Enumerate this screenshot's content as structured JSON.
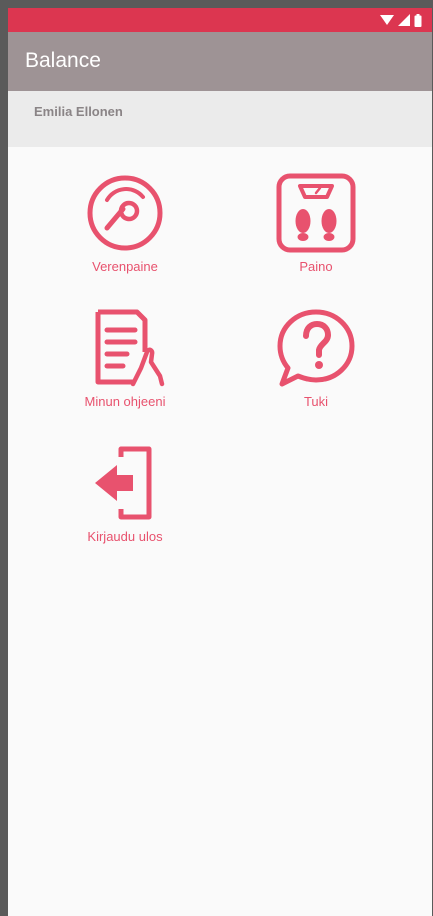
{
  "app_bar": {
    "title": "Balance"
  },
  "user": {
    "name": "Emilia Ellonen"
  },
  "tiles": [
    {
      "label": "Verenpaine",
      "icon": "gauge-icon"
    },
    {
      "label": "Paino",
      "icon": "scale-icon"
    },
    {
      "label": "Minun ohjeeni",
      "icon": "document-hand-icon"
    },
    {
      "label": "Tuki",
      "icon": "help-bubble-icon"
    },
    {
      "label": "Kirjaudu ulos",
      "icon": "logout-door-icon"
    }
  ],
  "colors": {
    "status_bar": "#dc3650",
    "app_bar": "#9e9395",
    "accent": "#e8526e",
    "user_strip": "#ebebeb"
  }
}
